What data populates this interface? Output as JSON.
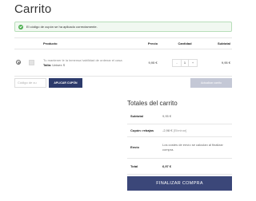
{
  "page": {
    "title": "Carrito"
  },
  "notice": {
    "message": "El código de cupón se ha aplicado correctamente."
  },
  "cart": {
    "headers": {
      "remove": "",
      "thumbnail": "",
      "product": "Producto",
      "price": "Precio",
      "quantity": "Cantidad",
      "subtotal": "Subtotal"
    },
    "items": [
      {
        "name": "Tu mantener le la inmensa habilidad de ordenar el casa",
        "variation_label": "Talla:",
        "variation_value": "Unisex S",
        "price": "9,95 €",
        "quantity": "1",
        "subtotal": "9,95 €"
      }
    ]
  },
  "coupon": {
    "placeholder": "Código de cu",
    "apply_label": "APLICAR CUPÓN",
    "update_label": "Actualizar carrito"
  },
  "totals": {
    "title": "Totales del carrito",
    "subtotal_label": "Subtotal",
    "subtotal_value": "9,95 €",
    "coupon_label": "Cupón: rebajas",
    "coupon_value": "-2,98 €",
    "coupon_remove": "[Eliminar]",
    "shipping_label": "Envío",
    "shipping_value": "Los costes de envío se calculan al finalizar compra.",
    "total_label": "Total",
    "total_value": "6,97 €"
  },
  "checkout": {
    "label": "FINALIZAR COMPRA"
  },
  "colors": {
    "primary": "#3b4779",
    "apply_button": "#2c3a6b",
    "update_button": "#c4c8d6",
    "notice_bg": "#f1f8f1",
    "notice_border": "#b7deb9",
    "success": "#4caf50"
  }
}
